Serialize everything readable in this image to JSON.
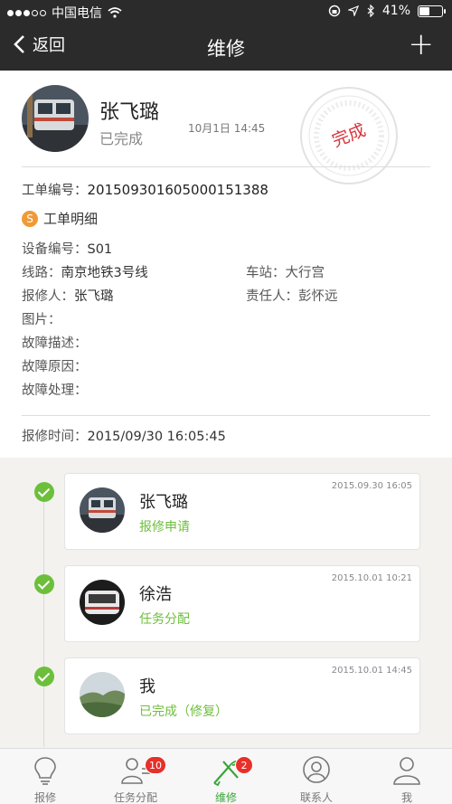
{
  "status_bar": {
    "carrier": "中国电信",
    "battery": "41%",
    "battery_level": 0.41
  },
  "nav": {
    "back_label": "返回",
    "title": "维修"
  },
  "header": {
    "name": "张飞璐",
    "status": "已完成",
    "time": "10月1日 14:45",
    "stamp_text": "完成"
  },
  "order": {
    "label": "工单编号：",
    "value": "20150930160500015138​8"
  },
  "detail": {
    "section_title": "工单明细",
    "section_badge": "S",
    "device_label": "设备编号：",
    "device_value": "S01",
    "line_label": "线路：",
    "line_value": "南京地铁3号线",
    "station_label": "车站：",
    "station_value": "大行宫",
    "reporter_label": "报修人：",
    "reporter_value": "张飞璐",
    "responsible_label": "责任人：",
    "responsible_value": "彭怀远",
    "image_label": "图片：",
    "fault_desc_label": "故障描述：",
    "fault_cause_label": "故障原因：",
    "fault_handle_label": "故障处理："
  },
  "report_time": {
    "label": "报修时间：",
    "value": "2015/09/30 16:05:45"
  },
  "timeline": [
    {
      "name": "张飞璐",
      "action": "报修申请",
      "time": "2015.09.30 16:05"
    },
    {
      "name": "徐浩",
      "action": "任务分配",
      "time": "2015.10.01 10:21"
    },
    {
      "name": "我",
      "action": "已完成（修复）",
      "time": "2015.10.01 14:45"
    }
  ],
  "tabs": [
    {
      "label": "报修",
      "icon": "lightbulb-icon"
    },
    {
      "label": "任务分配",
      "icon": "person-list-icon",
      "badge": "10"
    },
    {
      "label": "维修",
      "icon": "wrench-icon",
      "badge": "2",
      "active": true
    },
    {
      "label": "联系人",
      "icon": "contact-icon"
    },
    {
      "label": "我",
      "icon": "person-icon"
    }
  ],
  "colors": {
    "accent_green": "#6dbf3b",
    "badge_red": "#e8302a",
    "nav_bg": "#2b2b2b",
    "stamp_red": "#d9343c"
  }
}
